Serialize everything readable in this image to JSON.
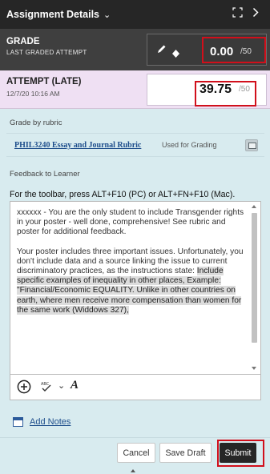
{
  "header": {
    "title": "Assignment Details",
    "icons": [
      "chevron-down-icon",
      "expand-icon",
      "chevron-right-icon"
    ]
  },
  "grade": {
    "label": "GRADE",
    "sublabel": "LAST GRADED ATTEMPT",
    "value": "0.00",
    "max": "/50"
  },
  "attempt": {
    "label": "ATTEMPT (LATE)",
    "date": "12/7/20 10:16 AM",
    "value": "39.75",
    "max": "/50"
  },
  "rubric": {
    "heading": "Grade by rubric",
    "name": "PHIL3240 Essay and Journal Rubric",
    "status": "Used for Grading"
  },
  "feedback": {
    "heading": "Feedback to Learner",
    "toolbar_hint": "For the toolbar, press ALT+F10 (PC) or ALT+FN+F10 (Mac).",
    "paragraph1": "xxxxxx - You are the only student to include Transgender rights in your poster - well done, comprehensive! See rubric and poster for additional feedback.",
    "paragraph2_plain": "Your poster includes three important issues. Unfortunately, you don't include data and a source linking the issue to current discriminatory practices, as the instructions state: ",
    "paragraph2_highlight": "Include specific examples of inequality in other places, Example: \"Financial/Economic EQUALITY. Unlike in other countries on earth, where men receive more compensation than women for the same work (Widdows 327),"
  },
  "notes": {
    "link": "Add Notes"
  },
  "actions": {
    "cancel": "Cancel",
    "save_draft": "Save Draft",
    "submit": "Submit"
  },
  "colors": {
    "header_bg": "#262626",
    "grade_bg": "#3f3f3f",
    "attempt_bg": "#efe0f3",
    "panel_bg": "#d8ebef",
    "highlight_outline": "#d10f1b",
    "link": "#1e4e8c"
  }
}
